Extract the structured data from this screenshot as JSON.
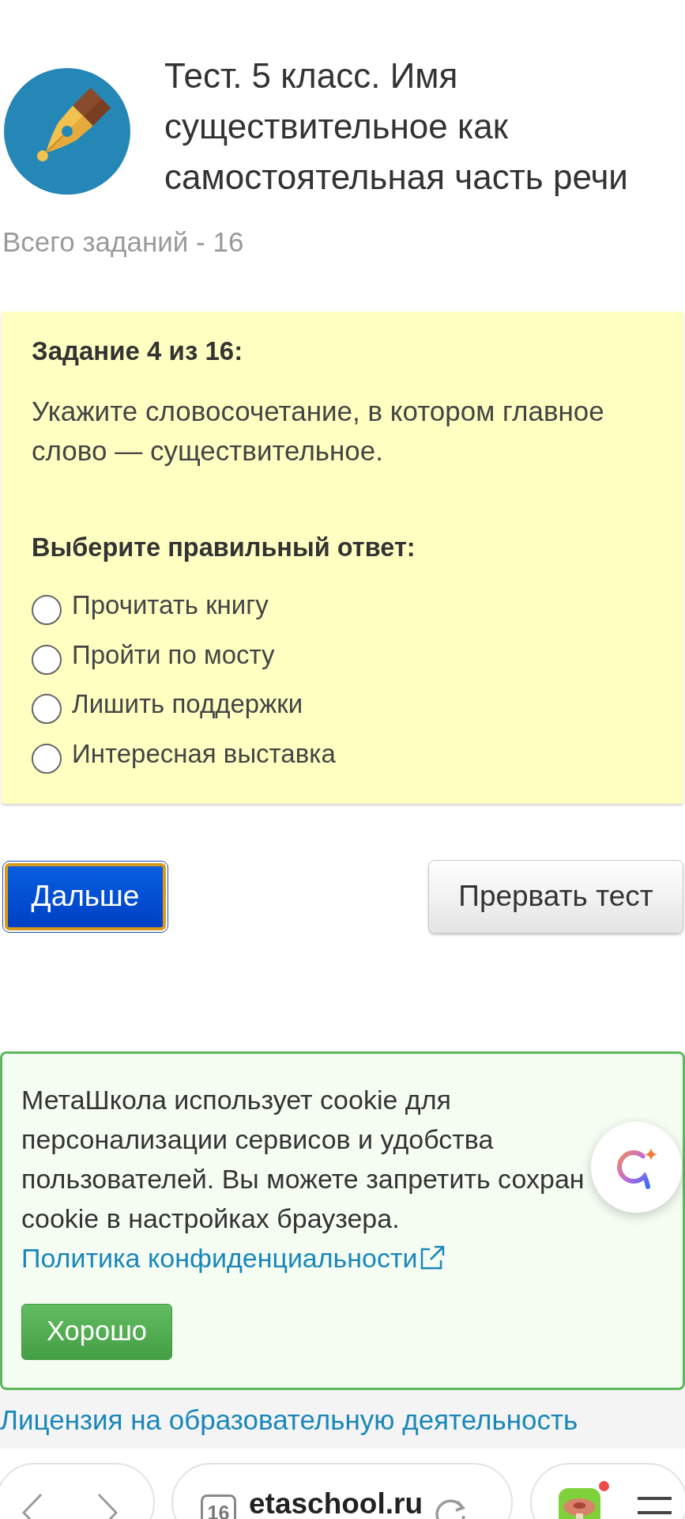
{
  "header": {
    "title": "Тест. 5 класс. Имя существительное как самостоятельная часть речи",
    "task_count": "Всего заданий - 16"
  },
  "question": {
    "heading": "Задание 4 из 16:",
    "text": "Укажите словосочетание, в котором главное слово — существительное.",
    "prompt": "Выберите правильный ответ:",
    "options": [
      {
        "label": "Прочитать книгу",
        "selected": false
      },
      {
        "label": "Пройти по мосту",
        "selected": false
      },
      {
        "label": "Лишить поддержки",
        "selected": false
      },
      {
        "label": "Интересная выставка",
        "selected": false
      }
    ]
  },
  "buttons": [
    {
      "kind": "primary",
      "label": "Дальше"
    },
    {
      "kind": "secondary",
      "label": "Прервать тест"
    }
  ],
  "cookie_notice": {
    "text": "МетаШкола использует cookie для\nперсонализации сервисов и удобства\nпользователей. Вы можете запретить сохран\ncookie в настройках браузера.",
    "link": "Политика конфиденциальности",
    "button": "Хорошо"
  },
  "footer": {
    "link": "Лицензия на образовательную деятельность"
  },
  "browser_bar": {
    "tab_count": "16",
    "url": "etaschool.ru"
  }
}
